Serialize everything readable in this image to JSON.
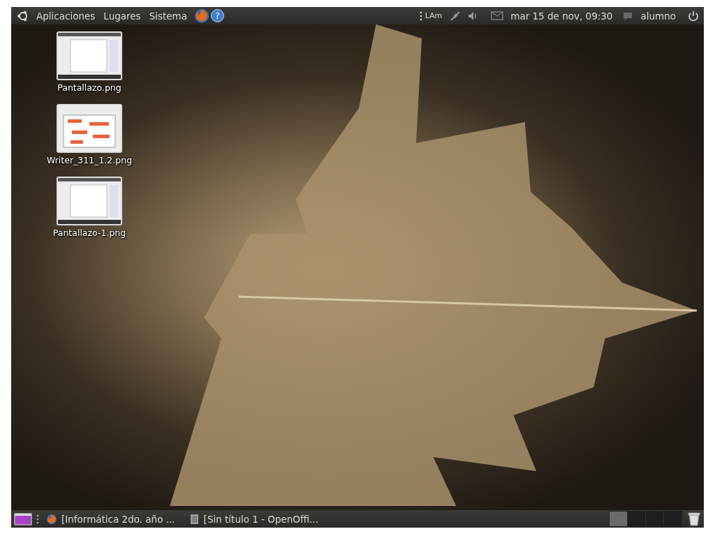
{
  "top_panel": {
    "menus": [
      "Aplicaciones",
      "Lugares",
      "Sistema"
    ],
    "help_button": "?",
    "keyboard_layout": "LAm",
    "clock": "mar 15 de nov, 09:30",
    "user": "alumno"
  },
  "desktop_icons": [
    {
      "label": "Pantallazo.png",
      "kind": "plain"
    },
    {
      "label": "Writer_311_1.2.png",
      "kind": "annotated"
    },
    {
      "label": "Pantallazo-1.png",
      "kind": "plain"
    }
  ],
  "bottom_panel": {
    "tasks": [
      {
        "label": "[Informática 2do. año ...",
        "kind": "browser"
      },
      {
        "label": "[Sin título 1 - OpenOffi...",
        "kind": "document"
      }
    ],
    "workspaces": [
      {
        "selected": true
      },
      {
        "selected": false
      },
      {
        "selected": false
      },
      {
        "selected": false
      }
    ]
  }
}
